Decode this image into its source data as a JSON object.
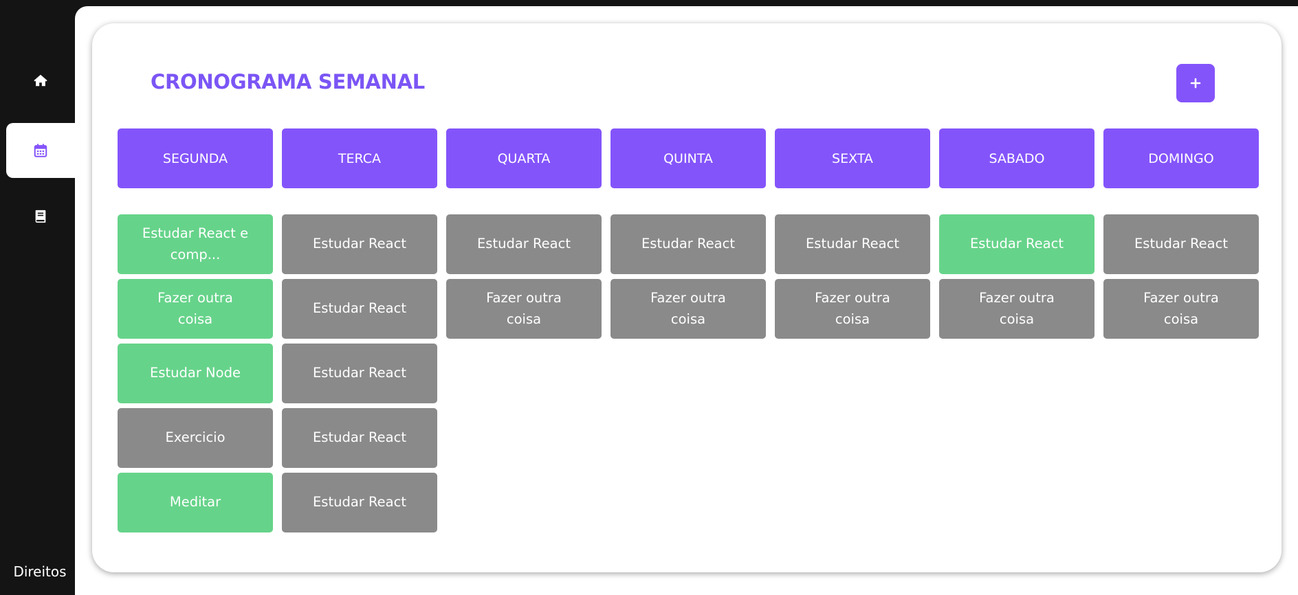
{
  "sidebar": {
    "items": [
      {
        "name": "home",
        "icon": "home-icon",
        "active": false
      },
      {
        "name": "schedule",
        "icon": "calendar-icon",
        "active": true
      },
      {
        "name": "book",
        "icon": "book-icon",
        "active": false
      }
    ],
    "footer_label": "Direitos"
  },
  "header": {
    "title": "CRONOGRAMA SEMANAL",
    "add_button_icon": "plus-icon"
  },
  "colors": {
    "accent": "#8454fb",
    "title": "#7b55f5",
    "done": "#66d38a",
    "pending": "#8a8a8a",
    "sidebar_bg": "#141414"
  },
  "days": [
    {
      "label": "SEGUNDA",
      "tasks": [
        {
          "text": "Estudar React e comp...",
          "status": "done"
        },
        {
          "text": "Fazer outra coisa",
          "status": "done"
        },
        {
          "text": "Estudar Node",
          "status": "done"
        },
        {
          "text": "Exercicio",
          "status": "pending"
        },
        {
          "text": "Meditar",
          "status": "done"
        }
      ]
    },
    {
      "label": "TERCA",
      "tasks": [
        {
          "text": "Estudar React",
          "status": "pending"
        },
        {
          "text": "Estudar React",
          "status": "pending"
        },
        {
          "text": "Estudar React",
          "status": "pending"
        },
        {
          "text": "Estudar React",
          "status": "pending"
        },
        {
          "text": "Estudar React",
          "status": "pending"
        }
      ]
    },
    {
      "label": "QUARTA",
      "tasks": [
        {
          "text": "Estudar React",
          "status": "pending"
        },
        {
          "text": "Fazer outra coisa",
          "status": "pending"
        }
      ]
    },
    {
      "label": "QUINTA",
      "tasks": [
        {
          "text": "Estudar React",
          "status": "pending"
        },
        {
          "text": "Fazer outra coisa",
          "status": "pending"
        }
      ]
    },
    {
      "label": "SEXTA",
      "tasks": [
        {
          "text": "Estudar React",
          "status": "pending"
        },
        {
          "text": "Fazer outra coisa",
          "status": "pending"
        }
      ]
    },
    {
      "label": "SABADO",
      "tasks": [
        {
          "text": "Estudar React",
          "status": "done"
        },
        {
          "text": "Fazer outra coisa",
          "status": "pending"
        }
      ]
    },
    {
      "label": "DOMINGO",
      "tasks": [
        {
          "text": "Estudar React",
          "status": "pending"
        },
        {
          "text": "Fazer outra coisa",
          "status": "pending"
        }
      ]
    }
  ]
}
